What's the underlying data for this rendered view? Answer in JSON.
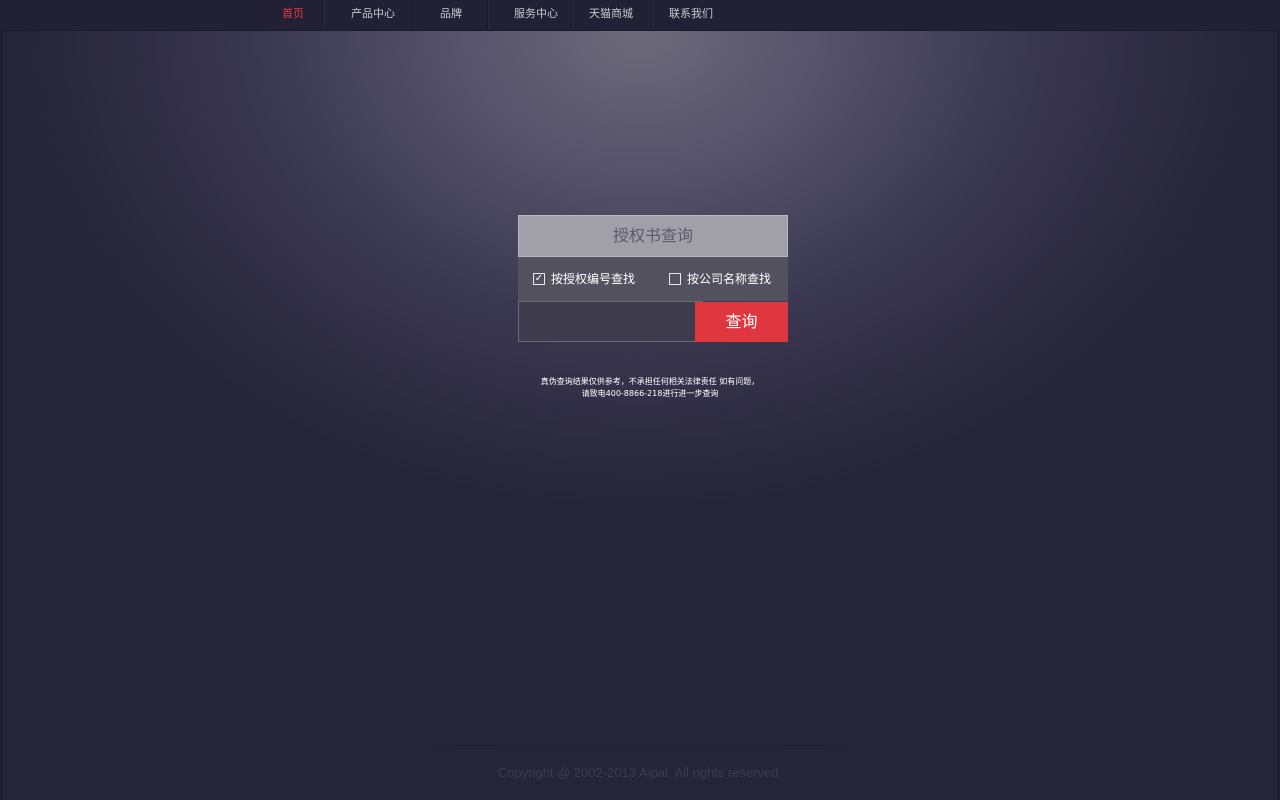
{
  "nav": {
    "items": [
      {
        "label": "首页",
        "active": true
      },
      {
        "label": "产品中心",
        "active": false
      },
      {
        "label": "品牌",
        "active": false
      },
      {
        "label": "服务中心",
        "active": false
      },
      {
        "label": "天猫商城",
        "active": false
      },
      {
        "label": "联系我们",
        "active": false
      }
    ]
  },
  "query": {
    "title": "授权书查询",
    "options": [
      {
        "label": "按授权编号查找",
        "checked": true
      },
      {
        "label": "按公司名称查找",
        "checked": false
      }
    ],
    "input_value": "",
    "button_label": "查询"
  },
  "notice": {
    "line1": "真伪查询结果仅供参考，不承担任何相关法律责任 如有问题，",
    "line2": "请致电400-8866-218进行进一步查询"
  },
  "footer": {
    "copyright": "Copyright @ 2002-2013 Aipal. All rights reserved."
  },
  "colors": {
    "accent": "#e0363f",
    "nav_active": "#e13a46",
    "background": "#262437"
  }
}
